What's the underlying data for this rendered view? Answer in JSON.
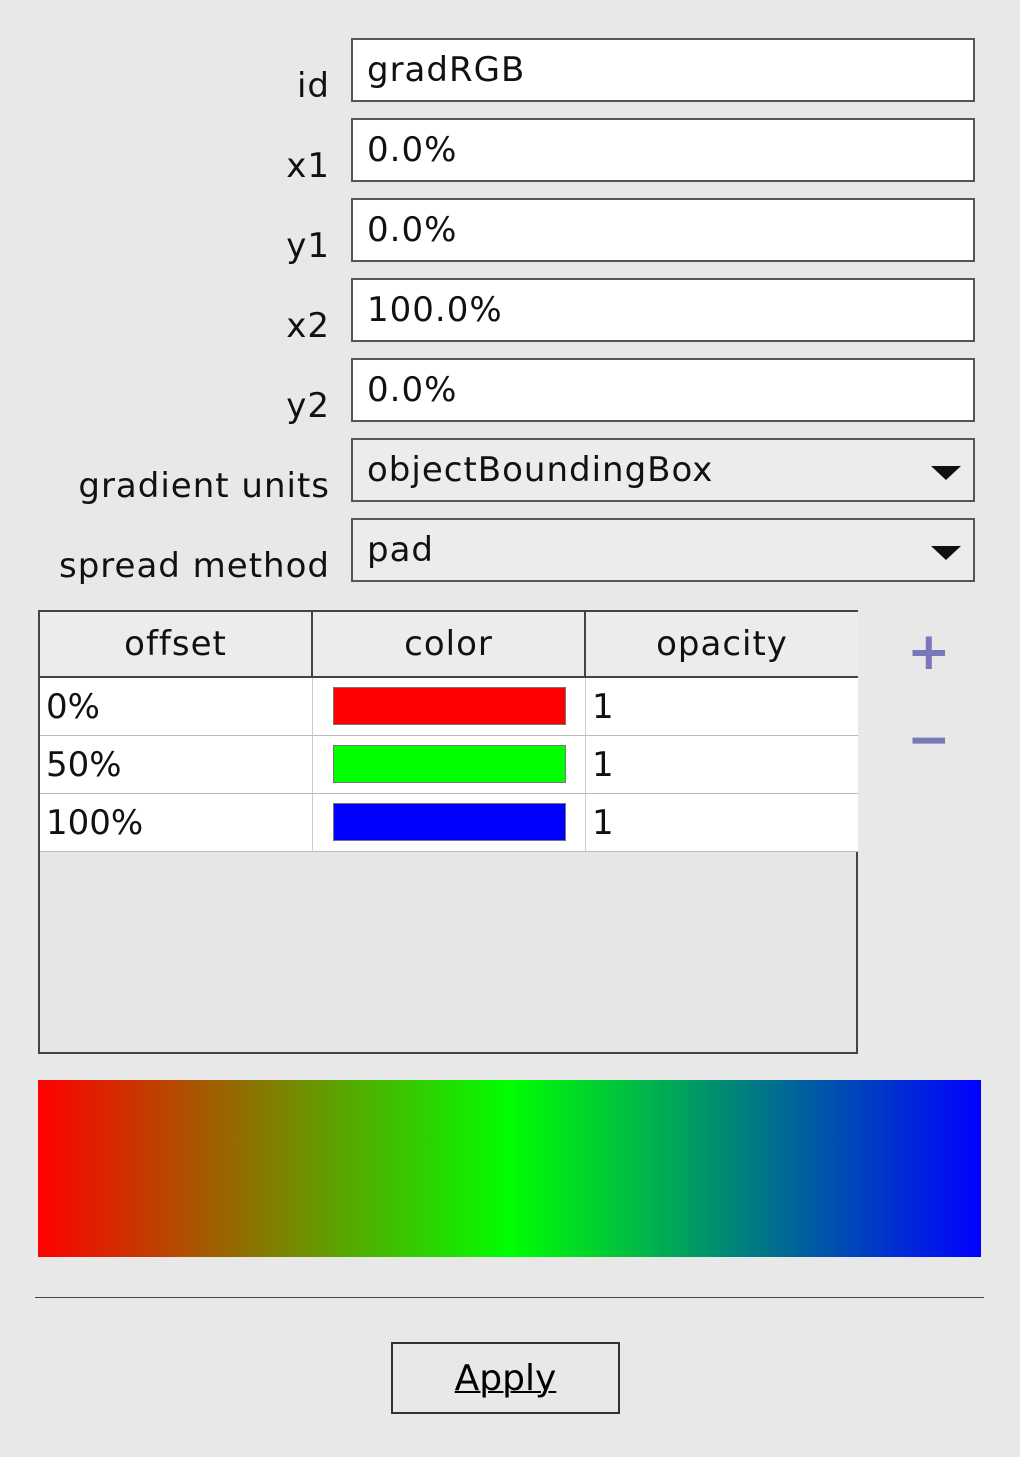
{
  "fields": [
    {
      "label": "id",
      "value": "gradRGB"
    },
    {
      "label": "x1",
      "value": "0.0%"
    },
    {
      "label": "y1",
      "value": "0.0%"
    },
    {
      "label": "x2",
      "value": "100.0%"
    },
    {
      "label": "y2",
      "value": "0.0%"
    }
  ],
  "gradient_units": {
    "label": "gradient units",
    "value": "objectBoundingBox"
  },
  "spread_method": {
    "label": "spread method",
    "value": "pad"
  },
  "table": {
    "headers": [
      "offset",
      "color",
      "opacity"
    ],
    "rows": [
      {
        "offset": "0%",
        "color": "#ff0000",
        "opacity": "1"
      },
      {
        "offset": "50%",
        "color": "#00ff00",
        "opacity": "1"
      },
      {
        "offset": "100%",
        "color": "#0000ff",
        "opacity": "1"
      }
    ]
  },
  "add_label": "+",
  "remove_label": "−",
  "apply_label": "Apply"
}
